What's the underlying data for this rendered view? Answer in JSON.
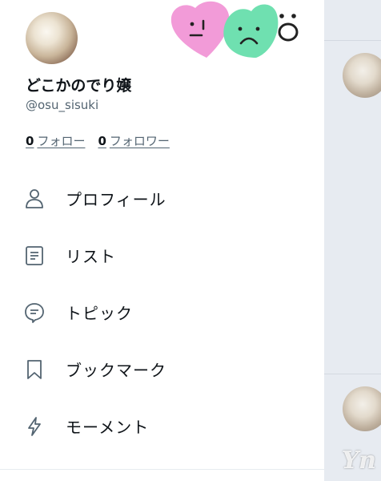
{
  "profile": {
    "display_name": "どこかのでり嬢",
    "handle": "@osu_sisuki",
    "following_count": "0",
    "following_label": "フォロー",
    "followers_count": "0",
    "followers_label": "フォロワー"
  },
  "menu": {
    "items": [
      {
        "label": "プロフィール",
        "icon": "person-icon"
      },
      {
        "label": "リスト",
        "icon": "list-icon"
      },
      {
        "label": "トピック",
        "icon": "topic-icon"
      },
      {
        "label": "ブックマーク",
        "icon": "bookmark-icon"
      },
      {
        "label": "モーメント",
        "icon": "lightning-icon"
      }
    ]
  },
  "stickers": [
    "pink-heart-face",
    "green-heart-face",
    "surprised-face"
  ],
  "colors": {
    "text_primary": "#0f1419",
    "text_secondary": "#536471",
    "backdrop": "#e7ebf1",
    "sticker_pink": "#f29bd8",
    "sticker_green": "#6fe0b0"
  }
}
